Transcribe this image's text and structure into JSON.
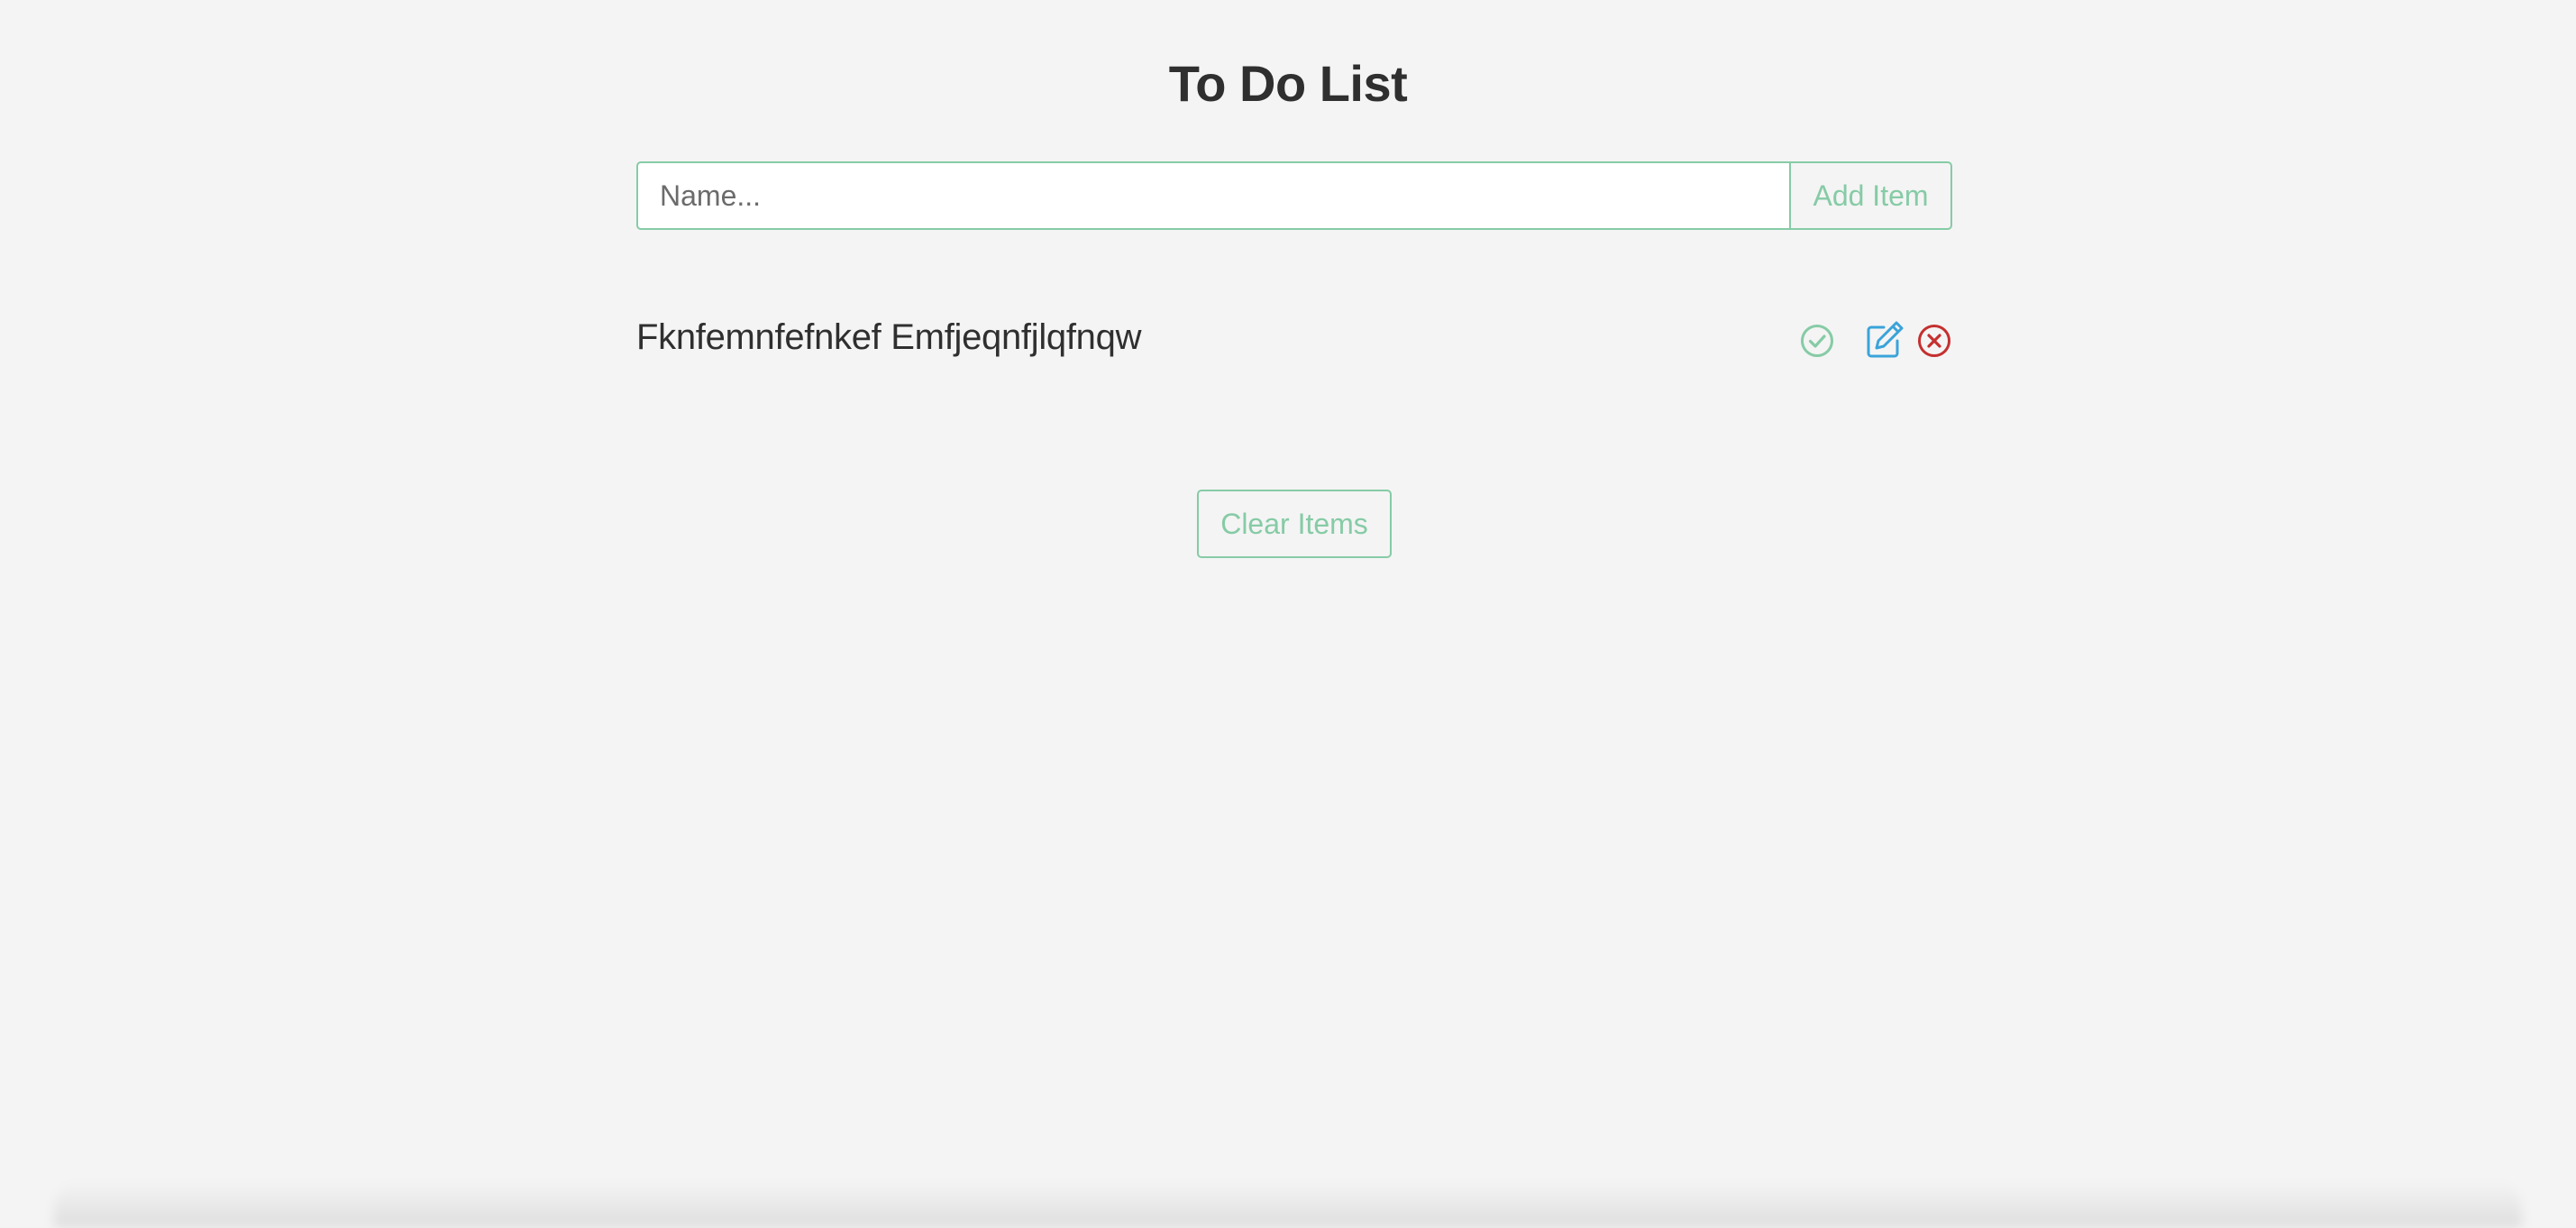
{
  "header": {
    "title": "To Do List"
  },
  "entry": {
    "input_value": "",
    "input_placeholder": "Name...",
    "add_label": "Add Item"
  },
  "items": [
    {
      "text": "Fknfemnfefnkef Emfjeqnfjlqfnqw",
      "actions": {
        "complete_icon": "check-circle-icon",
        "edit_icon": "edit-icon",
        "delete_icon": "x-circle-icon"
      }
    }
  ],
  "footer": {
    "clear_label": "Clear Items"
  },
  "colors": {
    "accent": "#86cba6",
    "edit": "#3aa3d9",
    "delete": "#c53030",
    "background": "#f4f4f4",
    "text": "#2f2f2f"
  }
}
